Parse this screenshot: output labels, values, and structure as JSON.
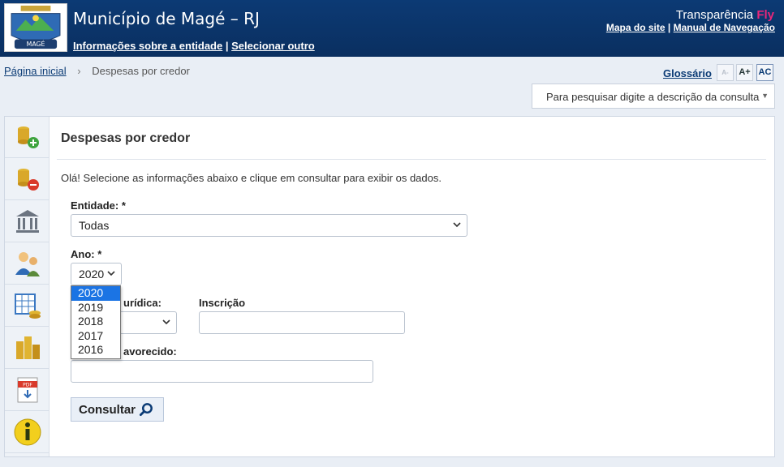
{
  "header": {
    "site_title": "Município de Magé – RJ",
    "entity_info_link": "Informações sobre a entidade",
    "link_separator": "|",
    "select_other_link": "Selecionar outro",
    "logo_text": "MAGÉ",
    "brand_name": "Transparência",
    "brand_accent": "Fly",
    "sitemap_link": "Mapa do site",
    "nav_manual_link": "Manual de Navegação"
  },
  "breadcrumb": {
    "home": "Página inicial",
    "separator": "›",
    "current": "Despesas por credor"
  },
  "toolbar": {
    "glossary": "Glossário",
    "font_decrease": "A-",
    "font_increase": "A+",
    "contrast": "AC",
    "search_placeholder": "Para pesquisar digite a descrição da consulta"
  },
  "sidebar": {
    "items": [
      {
        "name": "receitas-icon"
      },
      {
        "name": "despesas-icon"
      },
      {
        "name": "bank-icon"
      },
      {
        "name": "people-icon"
      },
      {
        "name": "spreadsheet-coins-icon"
      },
      {
        "name": "coin-stacks-icon"
      },
      {
        "name": "pdf-download-icon"
      },
      {
        "name": "info-icon"
      }
    ]
  },
  "main": {
    "title": "Despesas por credor",
    "intro": "Olá! Selecione as informações abaixo e clique em consultar para exibir os dados.",
    "entidade_label": "Entidade: *",
    "entidade_value": "Todas",
    "ano_label": "Ano: *",
    "ano_value": "2020",
    "ano_options": [
      "2020",
      "2019",
      "2018",
      "2017",
      "2016"
    ],
    "pessoa_label_visible": "urídica:",
    "inscricao_label": "Inscrição",
    "favorecido_label_visible": "avorecido:",
    "consultar_label": "Consultar"
  },
  "colors": {
    "header_bg": "#0a2f60",
    "accent": "#0b3b75",
    "brand_accent": "#e8267a",
    "selected_option": "#1b74e4"
  }
}
